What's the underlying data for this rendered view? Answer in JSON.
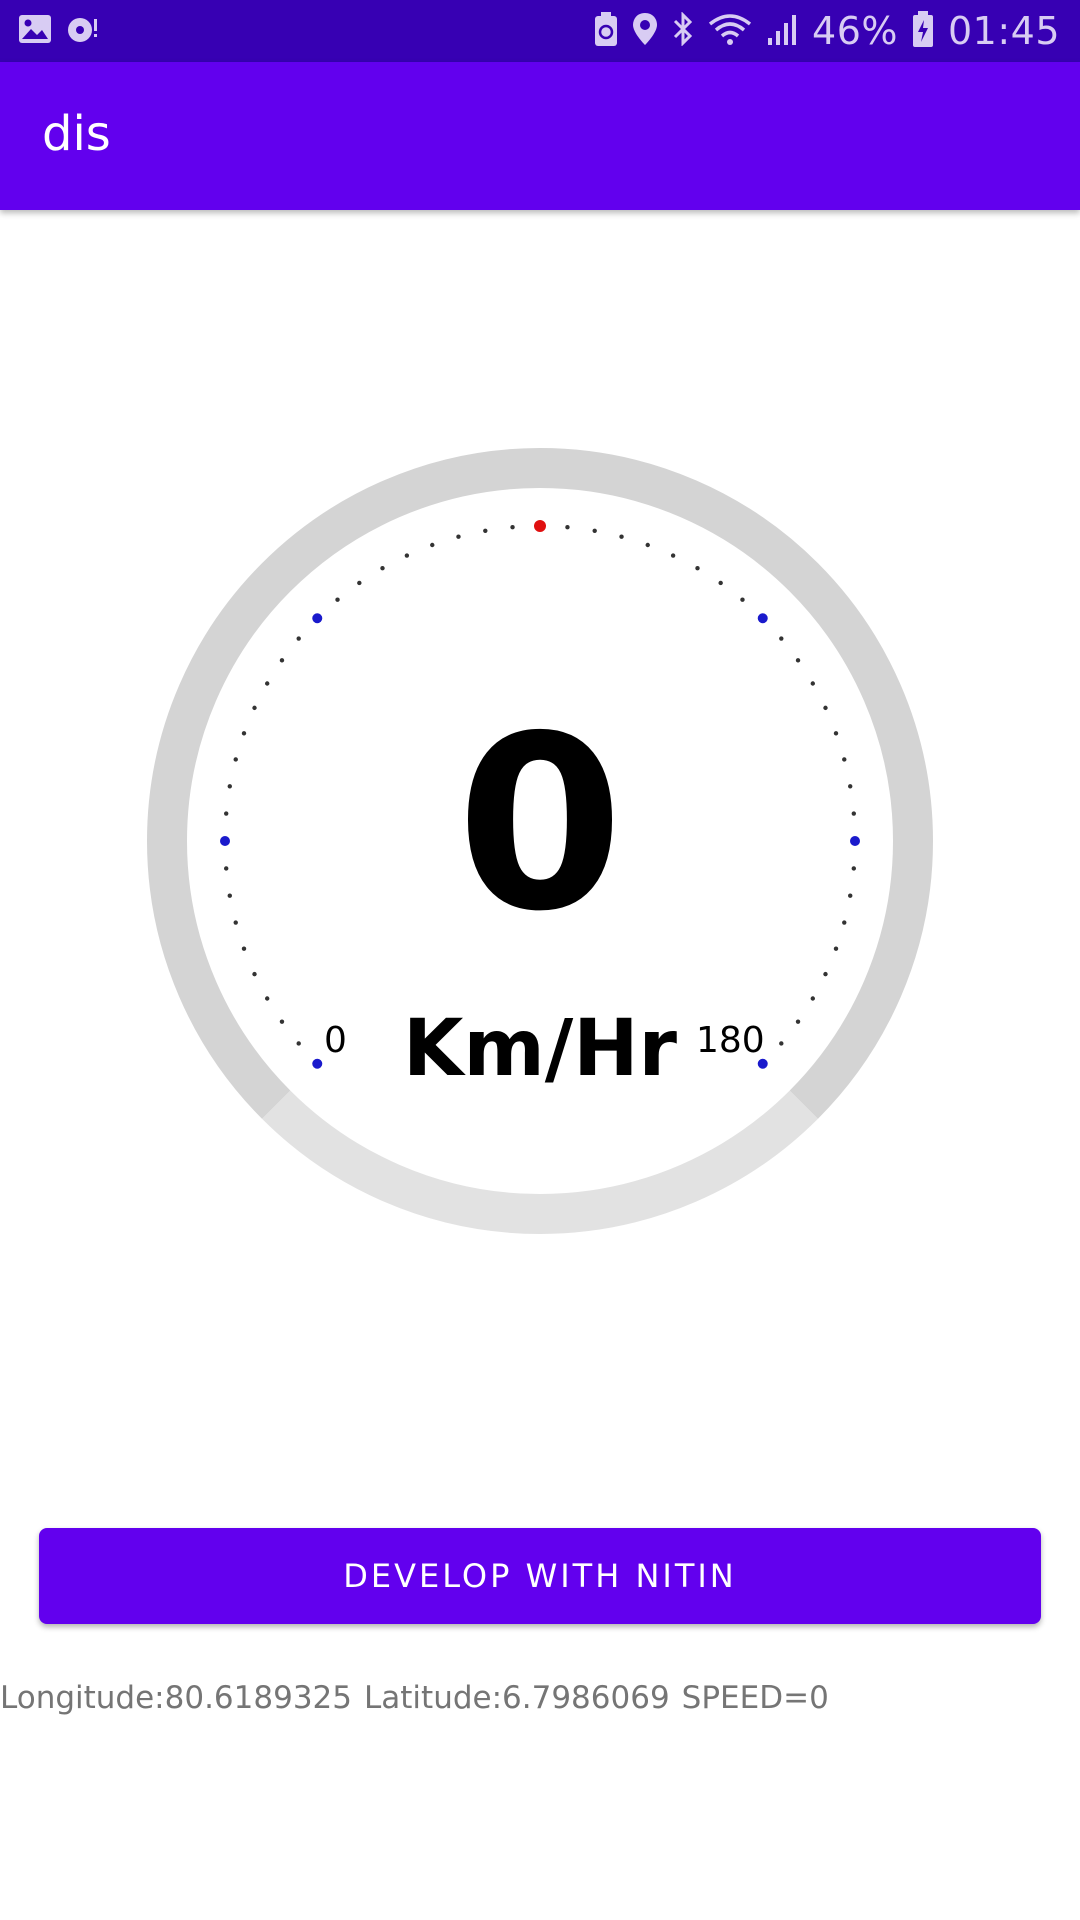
{
  "status_bar": {
    "battery_percent": "46%",
    "time": "01:45",
    "icons": [
      "gallery-icon",
      "music-notification-icon",
      "battery-saver-icon",
      "location-icon",
      "bluetooth-icon",
      "wifi-icon",
      "signal-icon",
      "battery-icon"
    ]
  },
  "app_bar": {
    "title": "dis"
  },
  "speedometer": {
    "value": "0",
    "unit": "Km/Hr",
    "min_label": "0",
    "max_label": "180",
    "speed_fraction": 0
  },
  "button": {
    "label": "DEVELOP WITH NITIN"
  },
  "location": {
    "longitude": "Longitude:80.6189325",
    "latitude": "Latitude:6.7986069",
    "speed": "SPEED=0"
  },
  "colors": {
    "status_bar": "#3700b3",
    "primary": "#6200ee",
    "gauge_track": "#d4d4d4",
    "gauge_track_light": "#e2e2e2",
    "tick_minor": "#333333",
    "tick_major": "#1a1acc",
    "tick_top": "#e01010"
  }
}
